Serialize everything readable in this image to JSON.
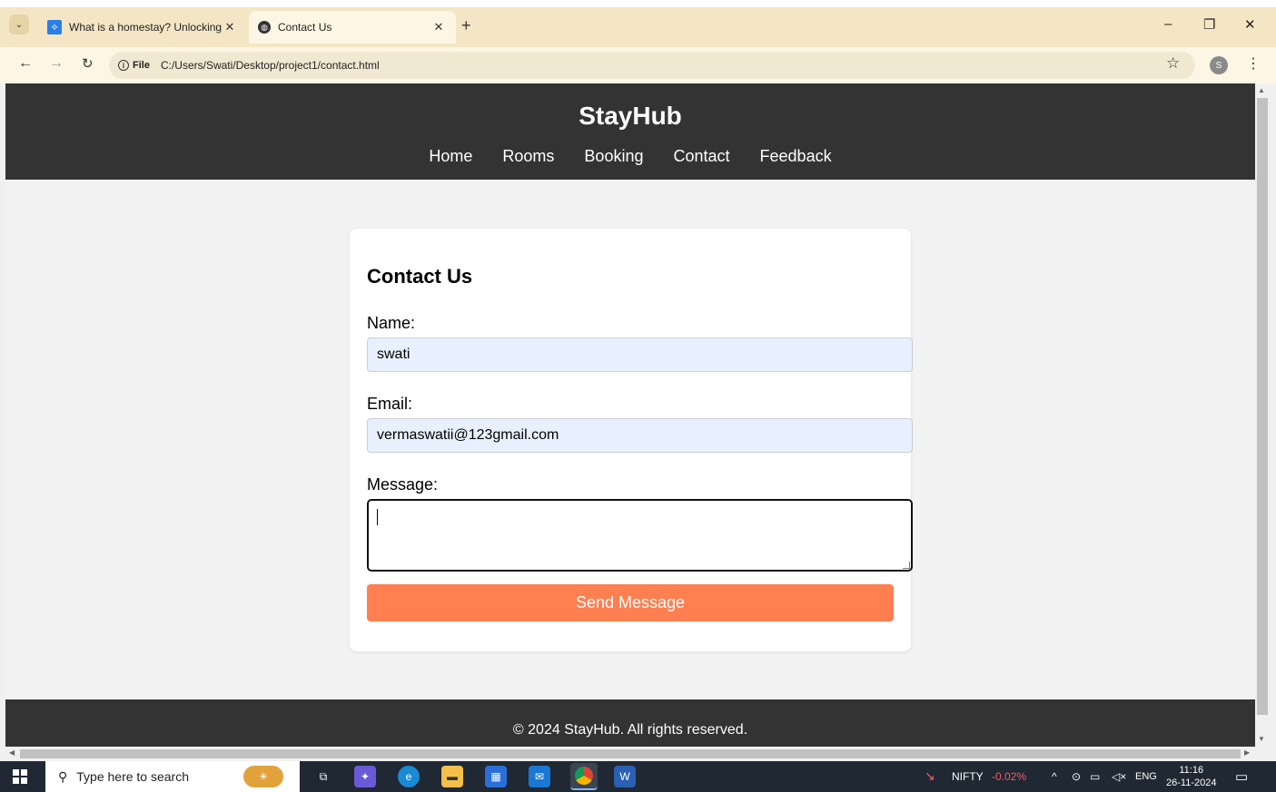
{
  "browser": {
    "tabs": [
      {
        "title": "What is a homestay? Unlocking",
        "active": false
      },
      {
        "title": "Contact Us",
        "active": true
      }
    ],
    "new_tab_icon": "+",
    "address_chip": "File",
    "url": "C:/Users/Swati/Desktop/project1/contact.html",
    "profile_initial": "S"
  },
  "site": {
    "title": "StayHub",
    "nav": [
      "Home",
      "Rooms",
      "Booking",
      "Contact",
      "Feedback"
    ]
  },
  "form": {
    "heading": "Contact Us",
    "name_label": "Name:",
    "name_value": "swati",
    "email_label": "Email:",
    "email_value": "vermaswatii@123gmail.com",
    "message_label": "Message:",
    "message_value": "",
    "submit_label": "Send Message"
  },
  "footer": {
    "text": "© 2024 StayHub. All rights reserved."
  },
  "taskbar": {
    "search_placeholder": "Type here to search",
    "market_name": "NIFTY",
    "market_change": "-0.02%",
    "language": "ENG",
    "time": "11:16",
    "date": "26-11-2024"
  },
  "colors": {
    "header_bg": "#333333",
    "button_bg": "#ff7f50",
    "input_autofill_bg": "#e8f0fe",
    "market_down": "#ff5a5a"
  }
}
